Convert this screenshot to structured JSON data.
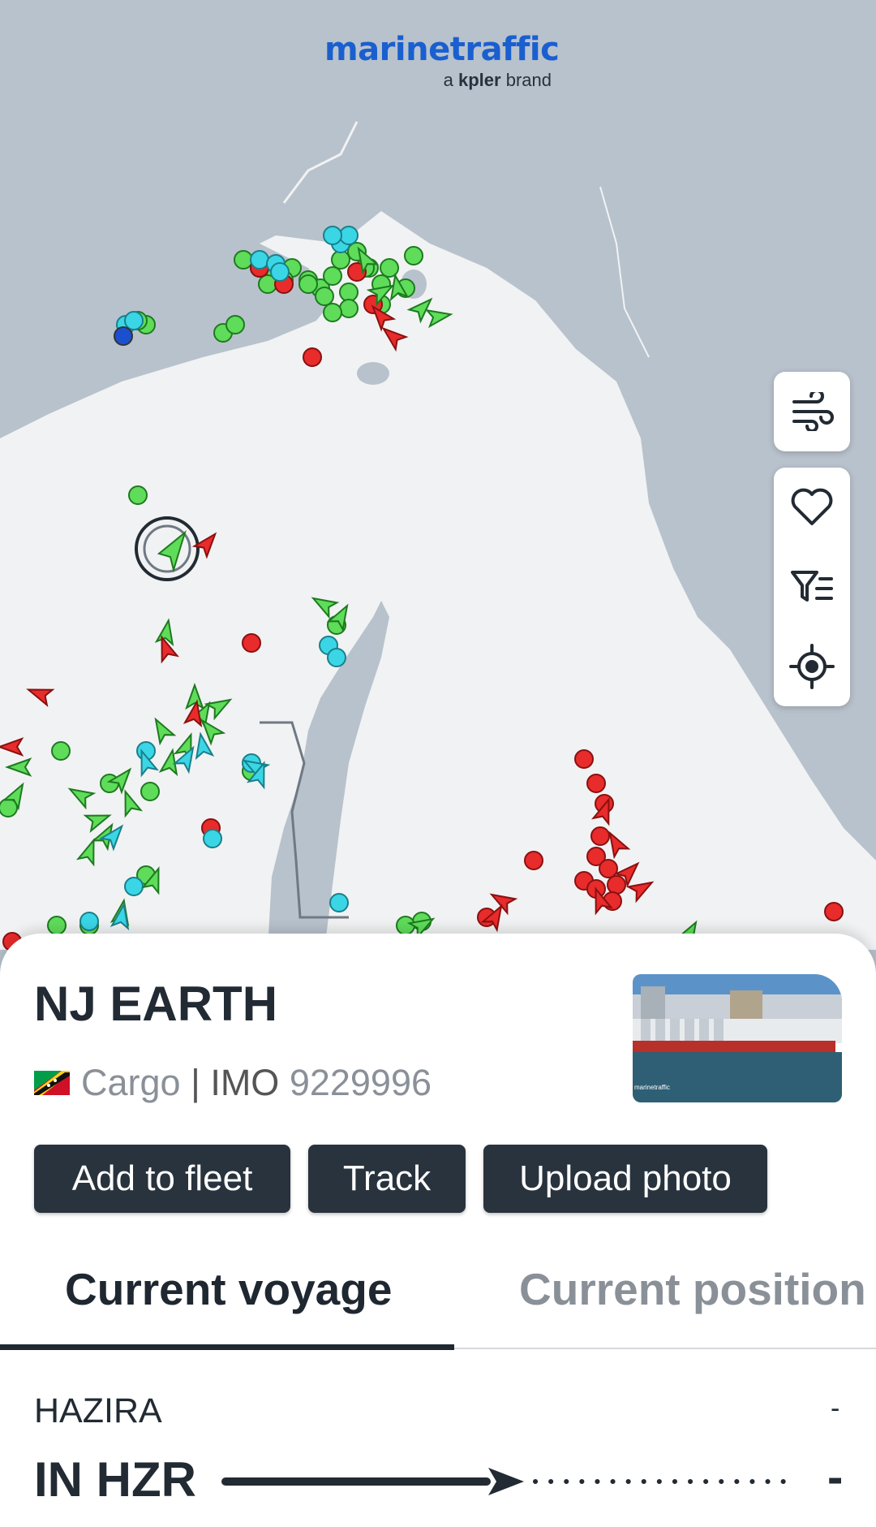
{
  "brand": {
    "name": "marinetraffic",
    "sub_prefix": "a",
    "sub_bold": "kpler",
    "sub_suffix": "brand"
  },
  "map_controls": [
    "wind-icon",
    "heart-icon",
    "filter-list-icon",
    "locate-icon"
  ],
  "vessel": {
    "name": "NJ EARTH",
    "type": "Cargo",
    "separator": "|",
    "imo_label": "IMO",
    "imo": "9229996",
    "photo_credit": "marinetraffic"
  },
  "actions": {
    "add_to_fleet": "Add to fleet",
    "track": "Track",
    "upload_photo": "Upload photo"
  },
  "tabs": {
    "current_voyage": "Current voyage",
    "current_position": "Current position"
  },
  "voyage": {
    "departure_port": "HAZIRA",
    "departure_code": "IN HZR",
    "arrival_port": "-",
    "arrival_code": "-"
  },
  "colors": {
    "brand": "#1a5fd0",
    "cargo_green": "#5fdc5a",
    "tanker_red": "#e82b2b",
    "passenger_cyan": "#3ad6e6",
    "button_dark": "#29333d"
  }
}
